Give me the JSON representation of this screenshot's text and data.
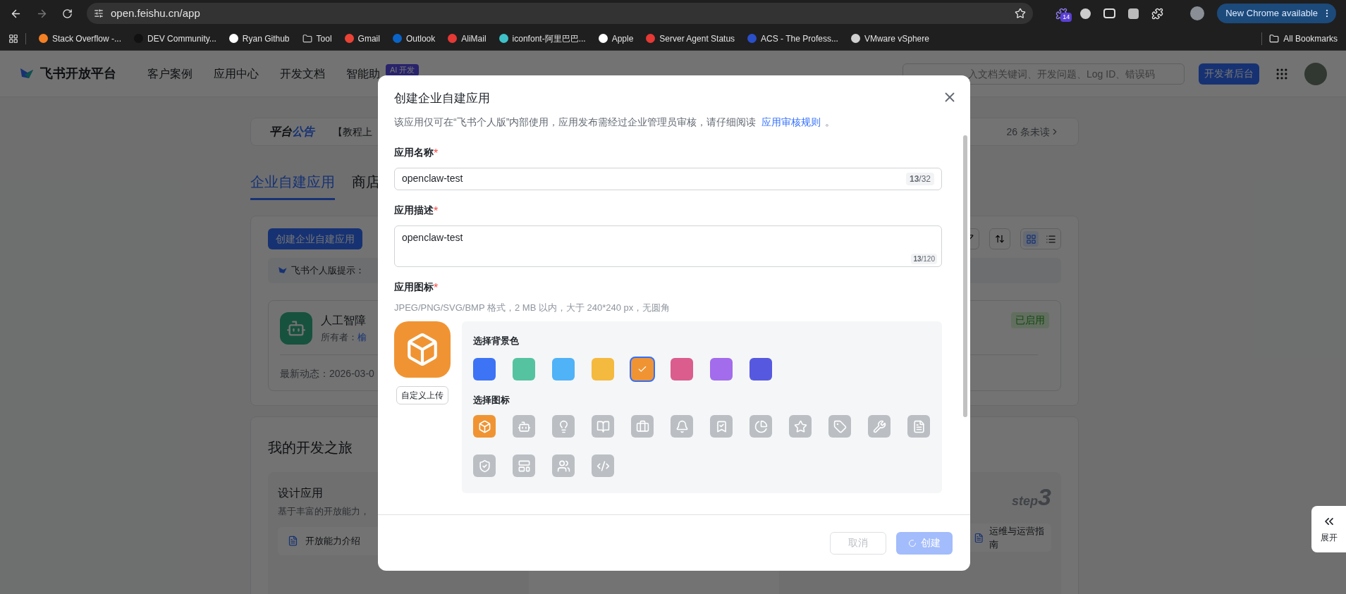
{
  "browser": {
    "url": "open.feishu.cn/app",
    "extension_badge": "14",
    "update_button": "New Chrome available",
    "bookmarks": [
      {
        "label": "Stack Overflow -...",
        "kind": "site",
        "color": "#f48024"
      },
      {
        "label": "DEV Community...",
        "kind": "site",
        "color": "#111111"
      },
      {
        "label": "Ryan Github",
        "kind": "site",
        "color": "#ffffff"
      },
      {
        "label": "Tool",
        "kind": "folder",
        "color": "#c8c8c8"
      },
      {
        "label": "Gmail",
        "kind": "site",
        "color": "#ea4335"
      },
      {
        "label": "Outlook",
        "kind": "site",
        "color": "#0a64c8"
      },
      {
        "label": "AliMail",
        "kind": "site",
        "color": "#e53935"
      },
      {
        "label": "iconfont-阿里巴巴...",
        "kind": "site",
        "color": "#3fc1c9"
      },
      {
        "label": "Apple",
        "kind": "site",
        "color": "#ffffff"
      },
      {
        "label": "Server Agent Status",
        "kind": "site",
        "color": "#e53935"
      },
      {
        "label": "ACS - The Profess...",
        "kind": "site",
        "color": "#2b4fc8"
      },
      {
        "label": "VMware vSphere",
        "kind": "site",
        "color": "#d0d0d0"
      }
    ],
    "all_bookmarks": "All Bookmarks"
  },
  "nav": {
    "brand": "飞书开放平台",
    "items": [
      "客户案例",
      "应用中心",
      "开发文档",
      "智能助"
    ],
    "ai_badge": "AI 开发",
    "search": {
      "placeholder": "入文档关键词、开发问题、Log ID、错误码"
    },
    "console_button": "开发者后台"
  },
  "announcement": {
    "title_plain": "平台",
    "title_accent": "公告",
    "text": "【教程上",
    "unread": "26 条未读"
  },
  "tabs": [
    {
      "label": "企业自建应用",
      "selected": true
    },
    {
      "label": "商店",
      "selected": false
    }
  ],
  "apps_panel": {
    "create_button": "创建企业自建应用",
    "tip": "飞书个人版提示：",
    "view_modes": [
      {
        "kind": "grid",
        "selected": true
      },
      {
        "kind": "list",
        "selected": false
      }
    ],
    "app": {
      "name": "人工智障",
      "owner_label": "所有者：",
      "owner": "榆",
      "status": "已启用",
      "activity": "最新动态：2026-03-0"
    }
  },
  "journey": {
    "title": "我的开发之旅",
    "step_title": "设计应用",
    "step_desc": "基于丰富的开放能力，",
    "step_link": "开放能力介绍",
    "step3_label": "step",
    "step3_number": "3",
    "ops_link": "运维与运营指南"
  },
  "side_button": {
    "label": "展开"
  },
  "dialog": {
    "title": "创建企业自建应用",
    "description": "该应用仅可在“飞书个人版”内部使用，应用发布需经过企业管理员审核，请仔细阅读",
    "rules_link": "应用审核规则",
    "description_end": "。",
    "fields": [
      {
        "label": "应用名称",
        "required_mark": "*",
        "kind": "input",
        "value": "openclaw-test",
        "counter": "**13**/32"
      },
      {
        "label": "应用描述",
        "required_mark": "*",
        "kind": "textarea",
        "value": "openclaw-test",
        "counter": "**13**/120"
      }
    ],
    "icon_section": {
      "label": "应用图标",
      "required_mark": "*",
      "hint": "JPEG/PNG/SVG/BMP 格式，2 MB 以内，大于 240*240 px，无圆角",
      "upload_button": "自定义上传",
      "background_title": "选择背景色",
      "colors": [
        {
          "color": "#3d73f5",
          "selected": false
        },
        {
          "color": "#55c3a0",
          "selected": false
        },
        {
          "color": "#50b2f7",
          "selected": false
        },
        {
          "color": "#f4b93f",
          "selected": false
        },
        {
          "color": "#f09433",
          "selected": true
        },
        {
          "color": "#da5d8d",
          "selected": false
        },
        {
          "color": "#a26cec",
          "selected": false
        },
        {
          "color": "#5659df",
          "selected": false
        }
      ],
      "icon_title": "选择图标",
      "icons": [
        {
          "selected": true
        },
        {
          "selected": false
        },
        {
          "selected": false
        },
        {
          "selected": false
        },
        {
          "selected": false
        },
        {
          "selected": false
        },
        {
          "selected": false
        },
        {
          "selected": false
        },
        {
          "selected": false
        },
        {
          "selected": false
        },
        {
          "selected": false
        },
        {
          "selected": false
        },
        {
          "selected": false
        },
        {
          "selected": false
        },
        {
          "selected": false
        },
        {
          "selected": false
        }
      ]
    },
    "cancel_button": {
      "label": "取消",
      "disabled": true
    },
    "create_button": {
      "label": "创建",
      "disabled": true,
      "loading": true
    }
  }
}
